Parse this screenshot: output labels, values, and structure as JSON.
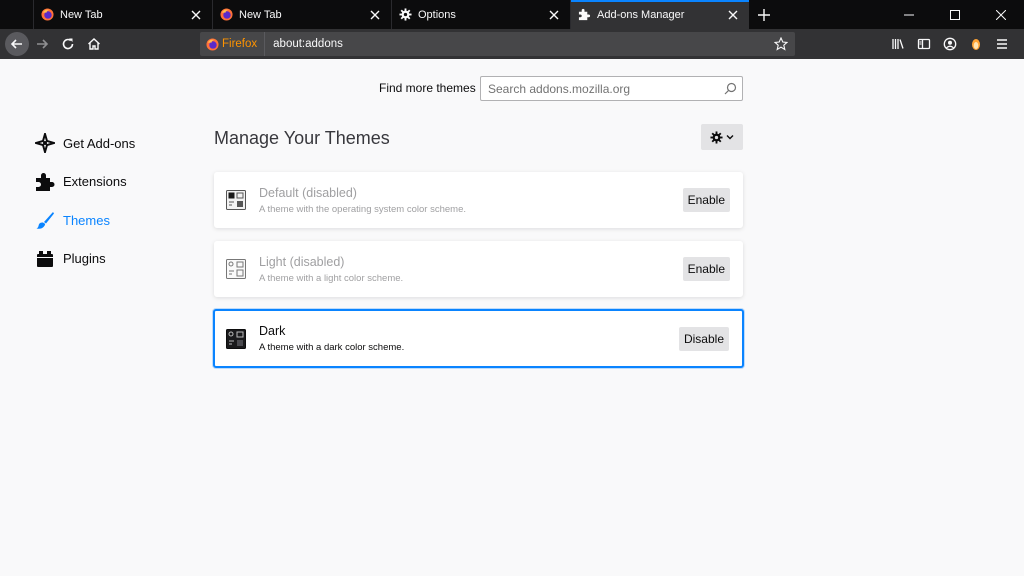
{
  "tabs": [
    {
      "title": "New Tab",
      "icon": "firefox-icon",
      "selected": false
    },
    {
      "title": "New Tab",
      "icon": "firefox-icon",
      "selected": false
    },
    {
      "title": "Options",
      "icon": "gear-icon",
      "selected": false
    },
    {
      "title": "Add-ons Manager",
      "icon": "puzzle-icon",
      "selected": true
    }
  ],
  "navbar": {
    "identity_label": "Firefox",
    "url": "about:addons"
  },
  "search": {
    "label": "Find more themes",
    "placeholder": "Search addons.mozilla.org"
  },
  "sidebar": {
    "items": [
      {
        "label": "Get Add-ons",
        "icon": "get-addons-icon",
        "selected": false
      },
      {
        "label": "Extensions",
        "icon": "extensions-puzzle-icon",
        "selected": false
      },
      {
        "label": "Themes",
        "icon": "brush-icon",
        "selected": true
      },
      {
        "label": "Plugins",
        "icon": "plugin-icon",
        "selected": false
      }
    ]
  },
  "main": {
    "heading": "Manage Your Themes",
    "themes": [
      {
        "name": "Default (disabled)",
        "description": "A theme with the operating system color scheme.",
        "button": "Enable",
        "state": "disabled"
      },
      {
        "name": "Light (disabled)",
        "description": "A theme with a light color scheme.",
        "button": "Enable",
        "state": "disabled"
      },
      {
        "name": "Dark",
        "description": "A theme with a dark color scheme.",
        "button": "Disable",
        "state": "active"
      }
    ]
  },
  "colors": {
    "accent": "#0a84ff",
    "tabstrip": "#0c0c0d",
    "toolbar": "#323234",
    "identity": "#ff9400"
  }
}
